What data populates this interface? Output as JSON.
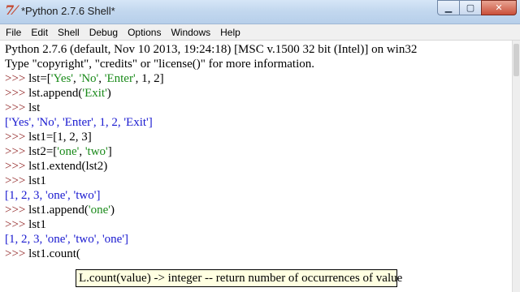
{
  "window": {
    "title": "*Python 2.7.6 Shell*",
    "icon": "idle-icon",
    "controls": {
      "minimize": "▁",
      "maximize": "▢",
      "close": "✕"
    }
  },
  "menu": [
    "File",
    "Edit",
    "Shell",
    "Debug",
    "Options",
    "Windows",
    "Help"
  ],
  "shell": {
    "banner_1": "Python 2.7.6 (default, Nov 10 2013, 19:24:18) [MSC v.1500 32 bit (Intel)] on win32",
    "banner_2": "Type \"copyright\", \"credits\" or \"license()\" for more information.",
    "prompt": ">>> ",
    "lines": {
      "l1": {
        "a": "lst=[",
        "s1": "'Yes'",
        "c1": ", ",
        "s2": "'No'",
        "c2": ", ",
        "s3": "'Enter'",
        "b": ", 1, 2]"
      },
      "l2": {
        "a": "lst.append(",
        "s1": "'Exit'",
        "b": ")"
      },
      "l3": "lst",
      "o1": "['Yes', 'No', 'Enter', 1, 2, 'Exit']",
      "l4": "lst1=[1, 2, 3]",
      "l5": {
        "a": "lst2=[",
        "s1": "'one'",
        "c1": ", ",
        "s2": "'two'",
        "b": "]"
      },
      "l6": "lst1.extend(lst2)",
      "l7": "lst1",
      "o2": "[1, 2, 3, 'one', 'two']",
      "l8": {
        "a": "lst1.append(",
        "s1": "'one'",
        "b": ")"
      },
      "l9": "lst1",
      "o3": "[1, 2, 3, 'one', 'two', 'one']",
      "l10": "lst1.count("
    }
  },
  "tooltip": "L.count(value) -> integer -- return number of occurrences of value",
  "colors": {
    "prompt": "#8b1a1a",
    "output": "#1a1ad0",
    "string": "#1a8a1a",
    "tooltip_bg": "#ffffe1"
  }
}
